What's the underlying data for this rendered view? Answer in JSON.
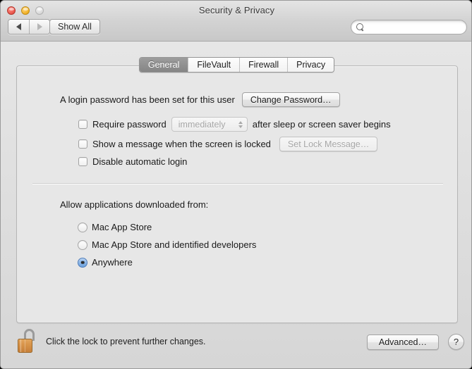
{
  "window": {
    "title": "Security & Privacy",
    "traffic_lights": [
      "close-button",
      "minimize-button",
      "zoom-button"
    ]
  },
  "toolbar": {
    "back_label": "◀",
    "forward_label": "▶",
    "show_all_label": "Show All",
    "search": {
      "value": "",
      "placeholder": "",
      "icon": "search-icon"
    }
  },
  "tabs": [
    {
      "label": "General",
      "active": true
    },
    {
      "label": "FileVault",
      "active": false
    },
    {
      "label": "Firewall",
      "active": false
    },
    {
      "label": "Privacy",
      "active": false
    }
  ],
  "general": {
    "login_password_text": "A login password has been set for this user",
    "change_password_button": "Change Password…",
    "require_password": {
      "checked": false,
      "label_before": "Require password",
      "popup_value": "immediately",
      "popup_enabled": false,
      "label_after": "after sleep or screen saver begins"
    },
    "lock_message": {
      "checked": false,
      "label": "Show a message when the screen is locked",
      "button": "Set Lock Message…",
      "button_enabled": false
    },
    "disable_auto_login": {
      "checked": false,
      "label": "Disable automatic login"
    },
    "gatekeeper": {
      "heading": "Allow applications downloaded from:",
      "options": [
        {
          "label": "Mac App Store",
          "selected": false
        },
        {
          "label": "Mac App Store and identified developers",
          "selected": false
        },
        {
          "label": "Anywhere",
          "selected": true
        }
      ]
    }
  },
  "footer": {
    "lock_icon": "unlocked-padlock-icon",
    "lock_caption": "Click the lock to prevent further changes.",
    "advanced_button": "Advanced…",
    "help_button": "?"
  },
  "colors": {
    "selected_radio": "#6fa3de",
    "active_tab_bg": "#8f8f8f",
    "panel_bg": "#e7e7e7",
    "lock_body": "#d8944a"
  }
}
